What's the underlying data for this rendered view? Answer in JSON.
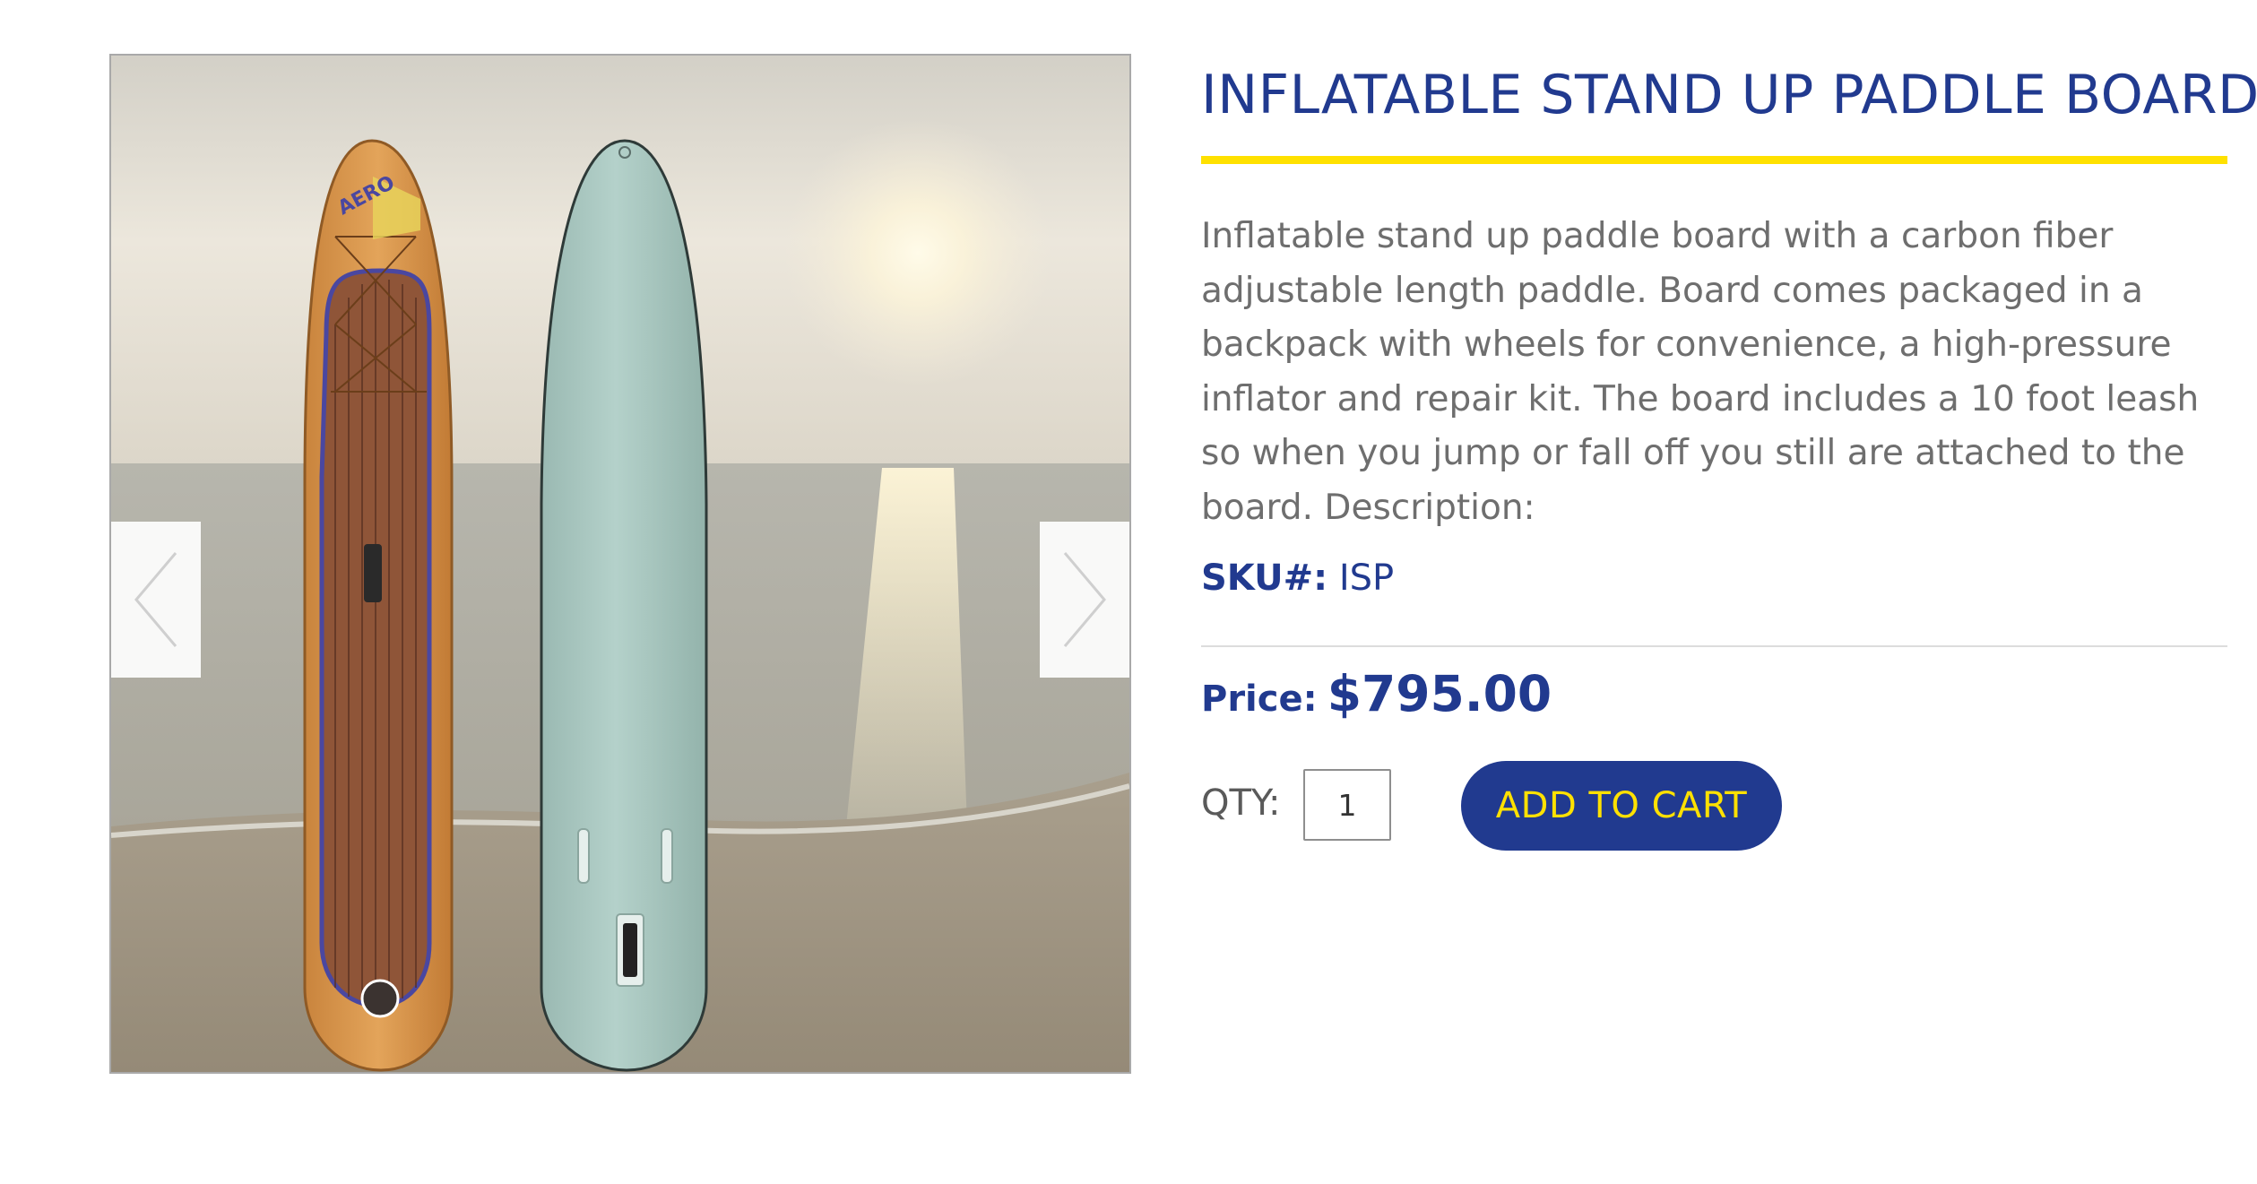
{
  "product": {
    "title": "INFLATABLE STAND UP PADDLE BOARD",
    "description": "Inflatable stand up paddle board with a carbon fiber adjustable length paddle. Board comes packaged in a backpack with wheels for convenience, a high-pressure inflator and repair kit. The board includes a 10 foot leash so when you jump or fall off you still are attached to the board. Description:",
    "sku_label": "SKU#:",
    "sku_value": "ISP",
    "price_label": "Price:",
    "price_value": "$795.00",
    "qty_label": "QTY:",
    "qty_value": "1",
    "add_to_cart_label": "ADD TO CART",
    "board_logo": "AERO"
  },
  "gallery": {
    "prev_icon": "chevron-left-icon",
    "next_icon": "chevron-right-icon"
  },
  "colors": {
    "brand_blue": "#213a8f",
    "accent_yellow": "#ffe100",
    "body_text": "#6e6e6e"
  }
}
